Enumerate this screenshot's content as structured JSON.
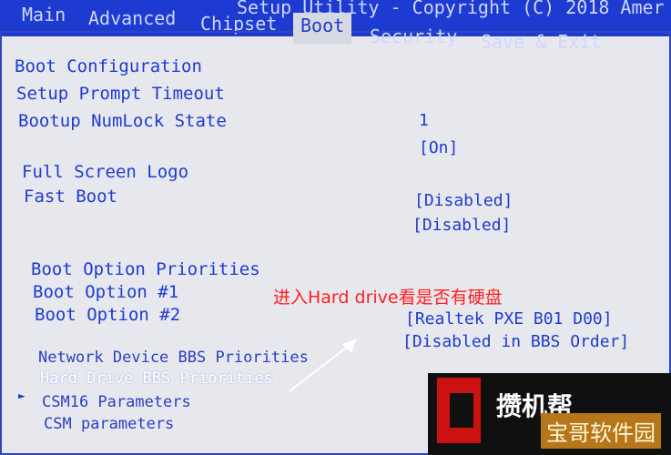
{
  "header": {
    "title": "Setup Utility - Copyright (C) 2018 Amer",
    "tabs": [
      {
        "label": "Main",
        "active": false
      },
      {
        "label": "Advanced",
        "active": false
      },
      {
        "label": "Chipset",
        "active": false
      },
      {
        "label": "Boot",
        "active": true
      },
      {
        "label": "Security",
        "active": false
      },
      {
        "label": "Save & Exit",
        "active": false
      }
    ]
  },
  "boot": {
    "config_heading": "Boot Configuration",
    "items": [
      {
        "label": "Setup Prompt Timeout",
        "value": "1"
      },
      {
        "label": "Bootup NumLock State",
        "value": "[On]"
      },
      {
        "label": "Full Screen Logo",
        "value": "[Disabled]"
      },
      {
        "label": "Fast Boot",
        "value": "[Disabled]"
      }
    ],
    "priorities_heading": "Boot Option Priorities",
    "options": [
      {
        "label": "Boot Option #1",
        "value": "[Realtek PXE B01 D00]"
      },
      {
        "label": "Boot Option #2",
        "value": "[Disabled in BBS Order]"
      }
    ],
    "submenus": [
      {
        "label": "Network Device BBS Priorities"
      },
      {
        "label": "Hard Drive BBS Priorities",
        "selected": true
      },
      {
        "label": "CSM16 Parameters",
        "pointer": "►"
      },
      {
        "label": "CSM parameters"
      }
    ]
  },
  "annotation": {
    "text": "进入Hard drive看是否有硬盘",
    "color": "#ff2020"
  },
  "watermark": {
    "top_text": "攒机帮",
    "bottom_text": "宝哥软件园"
  },
  "colors": {
    "accent": "#1d3bd0",
    "panel": "#e7e8ee",
    "annotation": "#ff2020"
  }
}
